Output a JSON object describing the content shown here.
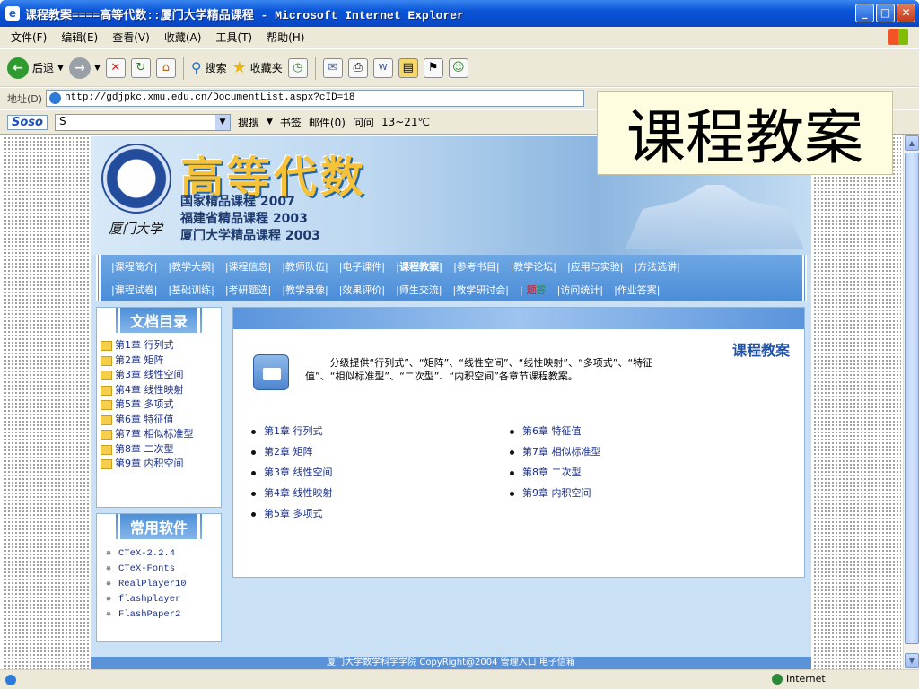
{
  "window": {
    "title": "课程教案====高等代数::厦门大学精品课程 - Microsoft Internet Explorer"
  },
  "menu": [
    "文件(F)",
    "编辑(E)",
    "查看(V)",
    "收藏(A)",
    "工具(T)",
    "帮助(H)"
  ],
  "toolbar": {
    "back": "后退",
    "search": "搜索",
    "favorites": "收藏夹"
  },
  "address": {
    "label": "地址(D)",
    "url": "http://gdjpkc.xmu.edu.cn/DocumentList.aspx?cID=18"
  },
  "soso": {
    "logo": "Soso",
    "input": "S",
    "search": "搜搜",
    "bookmarks": "书签",
    "mail": "邮件(0)",
    "ask": "问问",
    "weather": "13~21℃"
  },
  "overlay": {
    "text": "课程教案"
  },
  "site": {
    "title": "高等代数",
    "honors": [
      "国家精品课程 2007",
      "福建省精品课程 2003",
      "厦门大学精品课程 2003"
    ],
    "signature": "厦门大学",
    "nav_row1": [
      "|课程简介|",
      "|教学大纲|",
      "|课程信息|",
      "|教师队伍|",
      "|电子课件|",
      "|课程教案|",
      "|参考书目|",
      "|教学论坛|",
      "|应用与实验|",
      "|方法选讲|"
    ],
    "nav_row2": [
      "|课程试卷|",
      "|基础训练|",
      "|考研题选|",
      "|教学录像|",
      "|效果评价|",
      "|师生交流|",
      "|教学研讨会|",
      "|",
      "题",
      "答",
      "|访问统计|",
      "|作业答案|"
    ],
    "doc_title": "文档目录",
    "doc_items": [
      "第1章 行列式",
      "第2章 矩阵",
      "第3章 线性空间",
      "第4章 线性映射",
      "第5章 多项式",
      "第6章 特征值",
      "第7章 相似标准型",
      "第8章 二次型",
      "第9章 内积空间"
    ],
    "soft_title": "常用软件",
    "soft_items": [
      "CTeX-2.2.4",
      "CTeX-Fonts",
      "RealPlayer10",
      "flashplayer",
      "FlashPaper2"
    ],
    "panel_title": "课程教案",
    "description": "分级提供“行列式”、“矩阵”、“线性空间”、“线性映射”、“多项式”、“特征值”、“相似标准型”、“二次型”、“内积空间”各章节课程教案。",
    "chapters_left": [
      "第1章 行列式",
      "第2章 矩阵",
      "第3章 线性空间",
      "第4章 线性映射",
      "第5章 多项式"
    ],
    "chapters_right": [
      "第6章 特征值",
      "第7章 相似标准型",
      "第8章 二次型",
      "第9章 内积空间"
    ],
    "footer": "厦门大学数学科学学院 CopyRight@2004 管理入口 电子信箱"
  },
  "status": {
    "zone": "Internet"
  }
}
